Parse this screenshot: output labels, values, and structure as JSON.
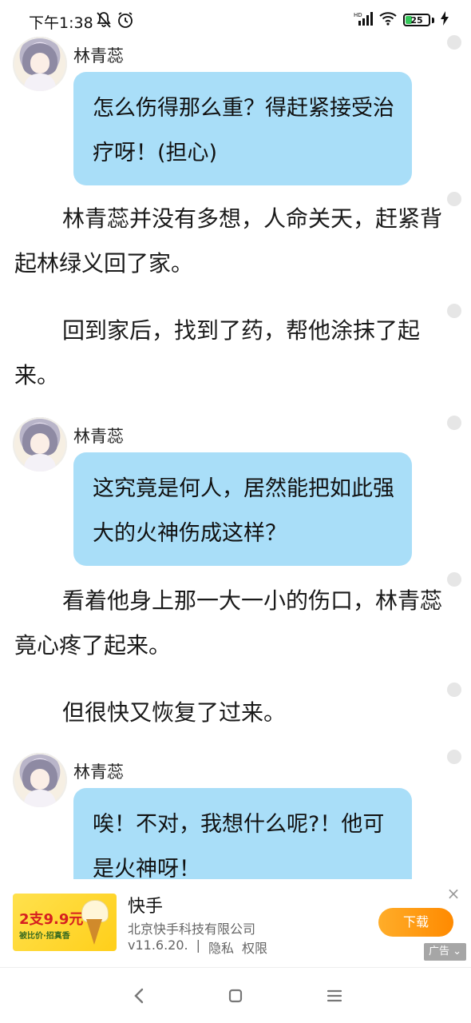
{
  "status_bar": {
    "time": "下午1:38",
    "battery": "25",
    "network": "HD"
  },
  "content": {
    "speaker_name": "林青蕊",
    "blocks": [
      {
        "type": "chat",
        "speaker": "林青蕊",
        "text": "怎么伤得那么重？得赶紧接受治疗呀！(担心)"
      },
      {
        "type": "para",
        "text": "林青蕊并没有多想，人命关天，赶紧背起林绿义回了家。"
      },
      {
        "type": "para",
        "text": "回到家后，找到了药，帮他涂抹了起来。"
      },
      {
        "type": "chat",
        "speaker": "林青蕊",
        "text": "这究竟是何人，居然能把如此强大的火神伤成这样？"
      },
      {
        "type": "para",
        "text": "看着他身上那一大一小的伤口，林青蕊竟心疼了起来。"
      },
      {
        "type": "para",
        "text": "但很快又恢复了过来。"
      },
      {
        "type": "chat",
        "speaker": "林青蕊",
        "text": "唉！不对，我想什么呢?！他可是火神呀！"
      }
    ]
  },
  "ad": {
    "image_price": "2支9.9元",
    "image_sub": "被比价·招真香",
    "title": "快手",
    "company": "北京快手科技有限公司",
    "version": "v11.6.20.",
    "privacy": "隐私",
    "permissions": "权限",
    "download": "下载",
    "tag": "广告",
    "close": "×"
  },
  "nav": {
    "back": "‹",
    "home": "▢",
    "menu": "≡"
  },
  "colors": {
    "bubble": "#a9def8",
    "ad_button": "#ff9a12",
    "battery": "#34c759"
  }
}
